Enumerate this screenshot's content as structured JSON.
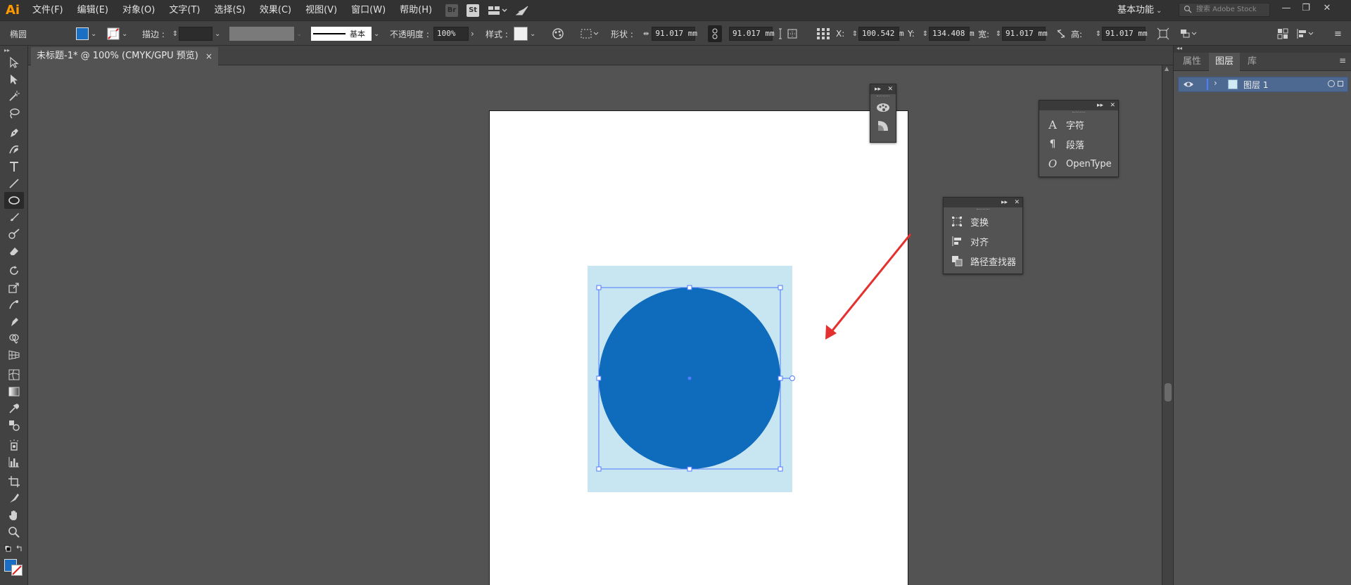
{
  "app": {
    "logo": "Ai",
    "menus": [
      "文件(F)",
      "编辑(E)",
      "对象(O)",
      "文字(T)",
      "选择(S)",
      "效果(C)",
      "视图(V)",
      "窗口(W)",
      "帮助(H)"
    ],
    "bridge_label": "Br",
    "stock_label": "St",
    "workspace": "基本功能",
    "search_placeholder": "搜索 Adobe Stock",
    "window_buttons": [
      "—",
      "❐",
      "✕"
    ]
  },
  "control_bar": {
    "tool_name": "椭圆",
    "fill_color": "#1a6fc4",
    "stroke_label": "描边 :",
    "stroke_profile": "基本",
    "opacity_label": "不透明度 :",
    "opacity_value": "100%",
    "style_label": "样式 :",
    "shape_label": "形状 :",
    "shape_width": "91.017 mm",
    "shape_height": "91.017 mm",
    "x_label": "X:",
    "x_value": "100.542 m",
    "y_label": "Y:",
    "y_value": "134.408 m",
    "w_label": "宽:",
    "w_value": "91.017 mm",
    "h_label": "高:",
    "h_value": "91.017 mm"
  },
  "document": {
    "tab_title": "未标题-1* @ 100% (CMYK/GPU 预览)",
    "close": "×",
    "circle_color": "#0f6cbd",
    "selection_bg_color": "#c8e6f2",
    "arrow_color": "#e53030"
  },
  "panels": {
    "type_panel": {
      "items": [
        {
          "icon": "A",
          "label": "字符"
        },
        {
          "icon": "¶",
          "label": "段落"
        },
        {
          "icon": "O",
          "label": "OpenType"
        }
      ]
    },
    "transform_panel": {
      "items": [
        {
          "label": "变换"
        },
        {
          "label": "对齐"
        },
        {
          "label": "路径查找器"
        }
      ]
    },
    "header_expand": "▸▸",
    "header_close": "✕"
  },
  "right_panel": {
    "tabs": [
      "属性",
      "图层",
      "库"
    ],
    "menu": "≡",
    "layer_name": "图层 1"
  }
}
